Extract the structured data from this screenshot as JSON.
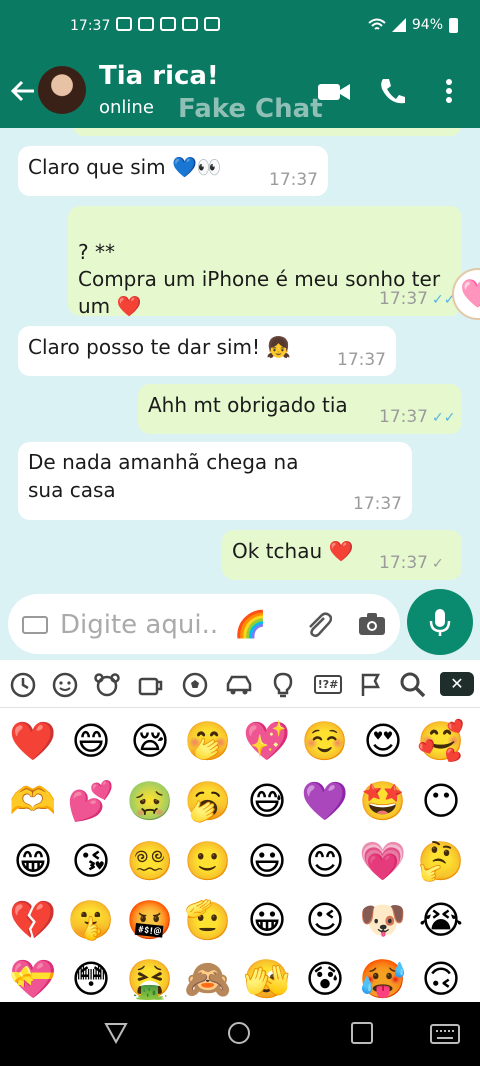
{
  "status_bar": {
    "time": "17:37",
    "battery": "94%"
  },
  "header": {
    "contact_name": "Tia rica!",
    "status": "online",
    "watermark": "Fake Chat"
  },
  "messages": [
    {
      "text": "Claro que sim 💙👀",
      "time": "17:37",
      "direction": "in"
    },
    {
      "text": "? **\nCompra um iPhone é meu sonho ter um ❤️",
      "time": "17:37",
      "direction": "out",
      "ticks": "read"
    },
    {
      "text": "Claro posso te dar sim! 👧",
      "time": "17:37",
      "direction": "in"
    },
    {
      "text": "Ahh mt obrigado tia",
      "time": "17:37",
      "direction": "out",
      "ticks": "read"
    },
    {
      "text": "De nada amanhã chega na sua casa",
      "time": "17:37",
      "direction": "in"
    },
    {
      "text": "Ok tchau ❤️",
      "time": "17:37",
      "direction": "out",
      "ticks": "sent"
    }
  ],
  "reaction_emoji": "🩷",
  "input": {
    "placeholder": "Digite aqui.. ",
    "emoji": "🌈"
  },
  "emoji_categories": [
    "recent-icon",
    "smiley-icon",
    "animal-icon",
    "food-icon",
    "sports-icon",
    "travel-icon",
    "objects-icon",
    "symbols-icon",
    "flag-icon",
    "search-icon"
  ],
  "emoji_grid": [
    [
      "❤️",
      "😄",
      "😪",
      "🤭",
      "💖",
      "☺️",
      "😍",
      "🥰"
    ],
    [
      "🫶",
      "💕",
      "🤢",
      "🥱",
      "😅",
      "💜",
      "🤩",
      "😶"
    ],
    [
      "😁",
      "😘",
      "😵‍💫",
      "🙂",
      "😃",
      "😊",
      "💗",
      "🤔"
    ],
    [
      "💔",
      "🤫",
      "🤬",
      "🫡",
      "😀",
      "😉",
      "🐶",
      "😭"
    ],
    [
      "💝",
      "😳",
      "🤮",
      "🙈",
      "🫣",
      "😰",
      "🥵",
      "🙃"
    ]
  ],
  "colors": {
    "header": "#0a7a62",
    "chat_bg": "#dbf2f4",
    "outgoing": "#e6f8cd",
    "incoming": "#ffffff",
    "accent": "#0a8a6e",
    "read_ticks": "#4fb5e6"
  }
}
